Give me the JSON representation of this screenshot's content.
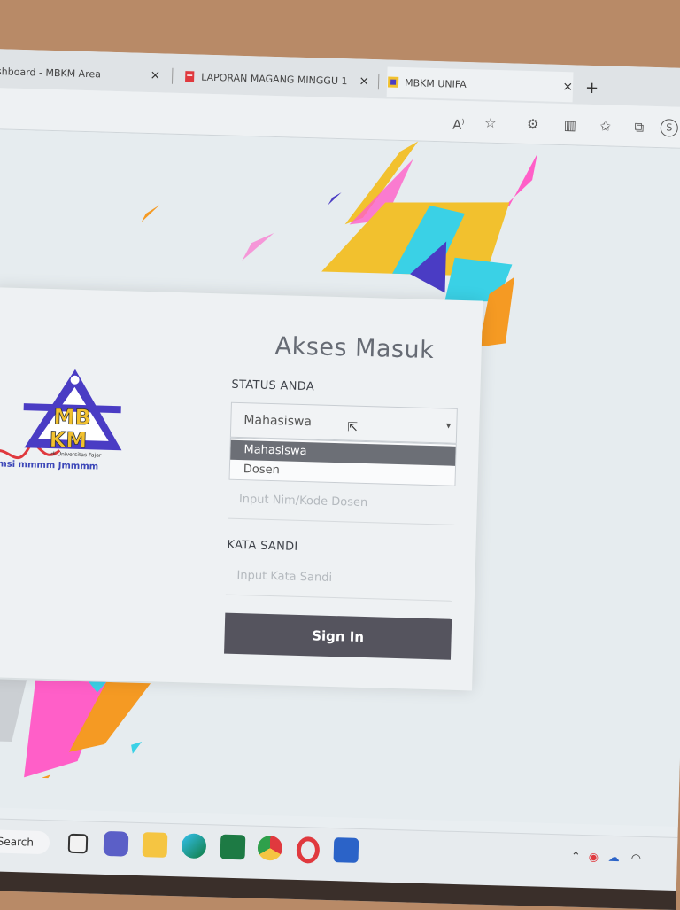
{
  "tabs": [
    {
      "title": "ashboard - MBKM Area",
      "close": "×"
    },
    {
      "title": "LAPORAN MAGANG MINGGU 1",
      "close": "×"
    },
    {
      "title": "MBKM UNIFA",
      "close": "×"
    }
  ],
  "new_tab": "+",
  "toolbar_icons": [
    "read-aloud-icon",
    "favorite-star-icon",
    "extensions-icon",
    "split-screen-icon",
    "favorites-icon",
    "collections-icon",
    "profile-icon"
  ],
  "login": {
    "title": "Akses Masuk",
    "status_label": "STATUS ANDA",
    "status_value": "Mahasiswa",
    "status_options": [
      "Mahasiswa",
      "Dosen"
    ],
    "nim_placeholder": "Input Nim/Kode Dosen",
    "password_label": "KATA SANDI",
    "password_placeholder": "Input Kata Sandi",
    "submit_label": "Sign In"
  },
  "logo": {
    "text_top": "MB",
    "text_bottom": "KM",
    "subtitle": "di Universitas Fajar",
    "tagline": "mmsi mmmm Jmmmm"
  },
  "taskbar": {
    "search_label": "Search",
    "apps": [
      "task-view",
      "meet",
      "file-explorer",
      "edge",
      "excel",
      "chrome",
      "opera",
      "word"
    ]
  },
  "colors": {
    "sign_in_button": "#55545e",
    "selected_option": "#6c6f76",
    "accent_yellow": "#f2c12e",
    "accent_pink": "#ff5fc8",
    "accent_cyan": "#3ad1e6",
    "accent_orange": "#f59a23"
  }
}
